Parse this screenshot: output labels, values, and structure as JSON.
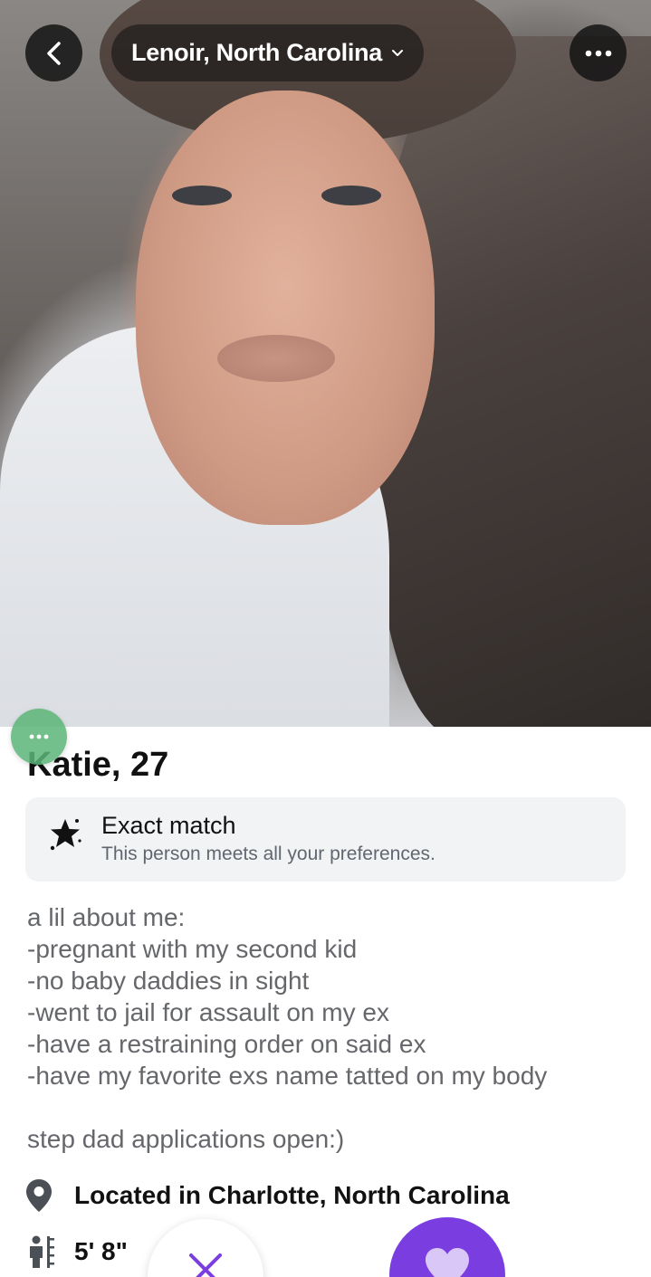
{
  "header": {
    "location_label": "Lenoir, North Carolina",
    "icons": {
      "back": "chevron-left-icon",
      "dropdown": "chevron-down-icon",
      "more": "more-horizontal-icon"
    }
  },
  "profile": {
    "name_age": "Katie, 27",
    "match": {
      "title": "Exact match",
      "subtitle": "This person meets all your preferences.",
      "icon": "sparkle-star-icon"
    },
    "bio_lines": [
      "a lil about me:",
      "-pregnant with my second kid",
      "-no baby daddies in sight",
      "-went to jail for assault on my ex",
      "-have a restraining order on said ex",
      "-have my favorite exs name tatted on my body"
    ],
    "bio_footer": "step dad applications open:)",
    "location": "Located in Charlotte, North Carolina",
    "height": "5' 8\""
  },
  "actions": {
    "pass_icon": "x-icon",
    "like_icon": "heart-icon",
    "chat_icon": "chat-bubble-icon"
  },
  "colors": {
    "accent": "#7a3ee0",
    "chat_bubble": "#5bb578",
    "card_bg": "#f2f3f5",
    "text_secondary": "#65676b"
  }
}
